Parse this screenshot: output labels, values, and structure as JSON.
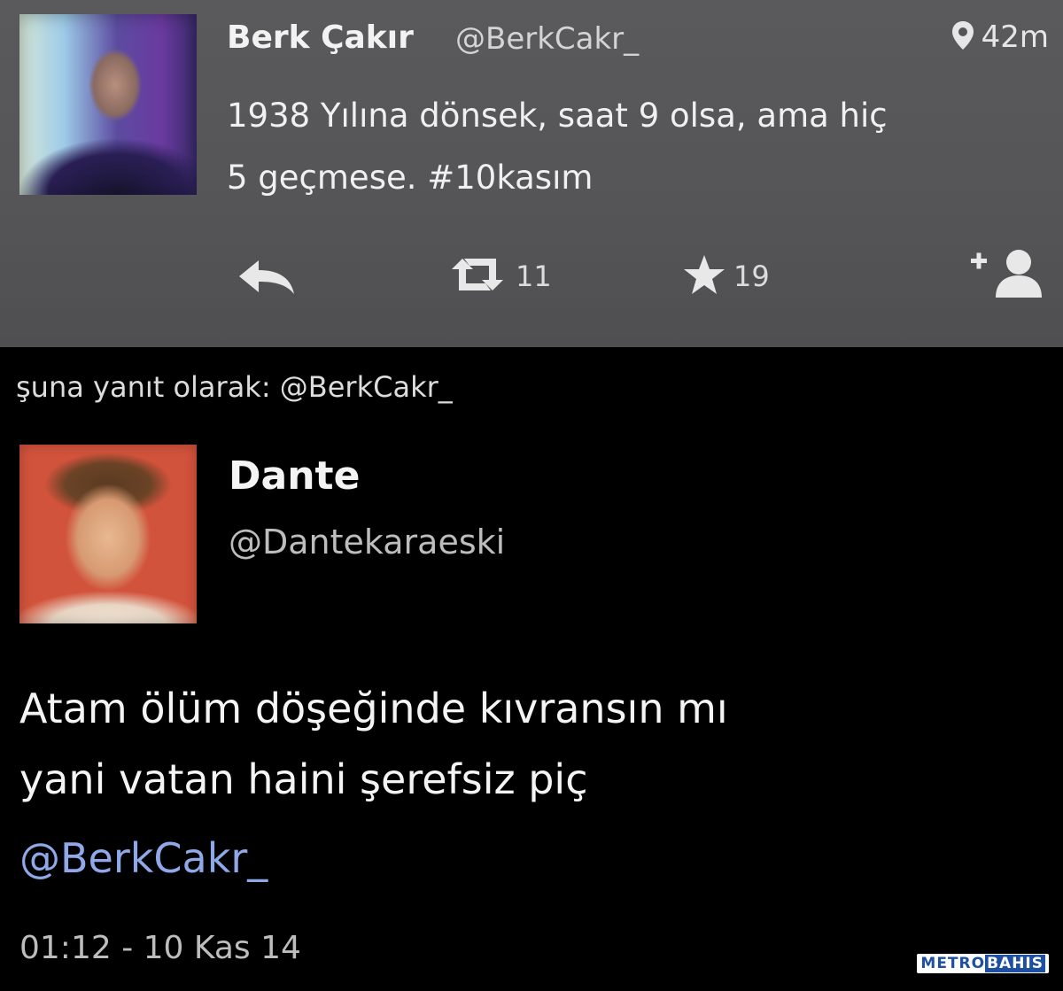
{
  "original_tweet": {
    "author_name": "Berk Çakır",
    "author_handle": "@BerkCakr_",
    "location_icon": "location-pin-icon",
    "time_ago": "42m",
    "text_line1": "1938 Yılına dönsek, saat 9 olsa, ama hiç",
    "text_line2": "5 geçmese. #10kasım",
    "actions": {
      "reply_icon": "reply-icon",
      "retweet_icon": "retweet-icon",
      "retweet_count": "11",
      "favorite_icon": "star-icon",
      "favorite_count": "19",
      "follow_icon": "add-user-icon"
    }
  },
  "reply_context": "şuna yanıt olarak: @BerkCakr_",
  "reply_tweet": {
    "author_name": "Dante",
    "author_handle": "@Dantekaraeski",
    "text_line1": "Atam ölüm döşeğinde kıvransın mı",
    "text_line2": "yani vatan haini şerefsiz piç",
    "mention": "@BerkCakr_",
    "timestamp": "01:12 - 10 Kas 14"
  },
  "watermark": {
    "part1": "METRO",
    "part2": "BAHIS"
  },
  "colors": {
    "card_background": "#555557",
    "page_background": "#000000",
    "mention_color": "#8fa8e8",
    "watermark_blue": "#1e4fa0"
  }
}
